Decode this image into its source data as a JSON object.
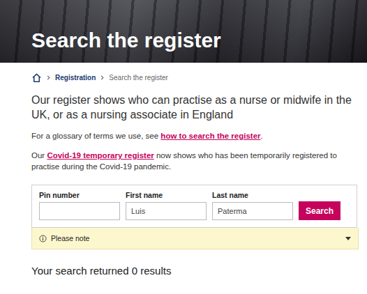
{
  "header": {
    "title": "Search the register"
  },
  "breadcrumb": [
    {
      "label": "Registration",
      "kind": "link"
    },
    {
      "label": "Search the register",
      "kind": "current"
    }
  ],
  "intro": "Our register shows who can practise as a nurse or midwife in the UK, or as a nursing associate in England",
  "glossary": {
    "before": "For a glossary of terms we use, see ",
    "link": "how to search the register",
    "after": "."
  },
  "covid": {
    "before": "Our ",
    "link": "Covid-19 temporary register",
    "after": " now shows who has been temporarily registered to practise during the Covid-19 pandemic."
  },
  "search_form": {
    "fields": [
      {
        "label": "Pin number",
        "value": ""
      },
      {
        "label": "First name",
        "value": "Luis"
      },
      {
        "label": "Last name",
        "value": "Paterma"
      }
    ],
    "button": "Search"
  },
  "notice": {
    "label": "Please note"
  },
  "results": "Your search returned 0 results"
}
